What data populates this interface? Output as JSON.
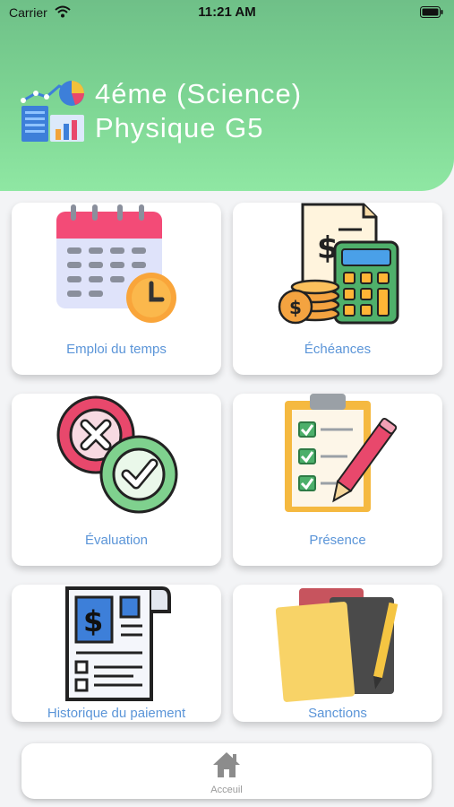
{
  "status_bar": {
    "carrier": "Carrier",
    "time": "11:21 AM"
  },
  "header": {
    "title_line1": "4éme (Science)",
    "title_line2": "Physique G5"
  },
  "menu": {
    "emploi": "Emploi du temps",
    "echeances": "Échéances",
    "evaluation": "Évaluation",
    "presence": "Présence",
    "historique": "Historique du paiement",
    "sanctions": "Sanctions"
  },
  "tabbar": {
    "home_label": "Acceuil"
  },
  "colors": {
    "header_green": "#7ed694",
    "label_blue": "#5b95d8",
    "background": "#f3f4f6"
  }
}
